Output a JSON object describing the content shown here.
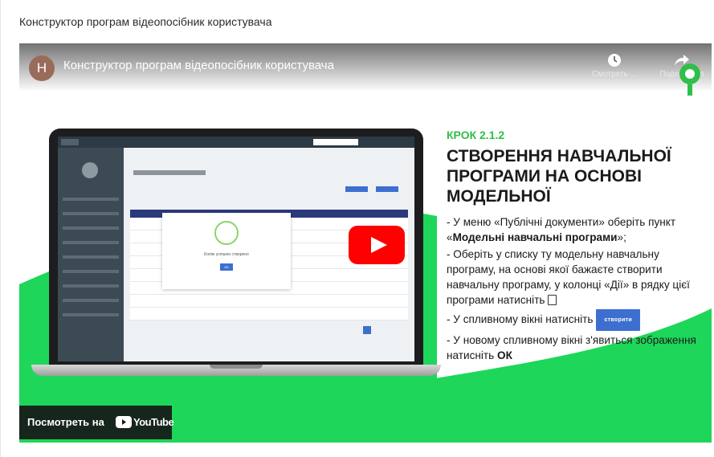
{
  "page": {
    "heading": "Конструктор програм відеопосібник користувача"
  },
  "video": {
    "channel_initial": "Н",
    "title": "Конструктор програм відеопосібник користувача",
    "watch_later_label": "Смотреть ...",
    "share_label": "Поделиться",
    "watch_on_label": "Посмотреть на",
    "youtube_word": "YouTube"
  },
  "slide": {
    "krok": "КРОК 2.1.2",
    "heading_line1": "СТВОРЕННЯ НАВЧАЛЬНОЇ",
    "heading_line2": "ПРОГРАМИ НА ОСНОВІ",
    "heading_line3": "МОДЕЛЬНОЇ",
    "step1_pre": "- У меню «Публічні документи» оберіть пункт «",
    "step1_bold": "Модельні навчальні програми",
    "step1_post": "»;",
    "step2": "- Оберіть у списку ту модельну навчальну програму, на основі якої бажаєте створити навчальну програму, у колонці «Дії» в рядку цієї програми натисніть",
    "step3": "- У спливному вікні натисніть",
    "create_button": "створити",
    "step4_pre": "- У новому спливному вікні з'явиться зображення натисніть ",
    "step4_bold": "ОК",
    "modal_text": "Копію успішно створено",
    "modal_ok": "ОК"
  },
  "colors": {
    "accent_green": "#2fbf4a",
    "swoosh_green": "#1ed65a",
    "button_blue": "#3d6fd1",
    "youtube_red": "#ff0000"
  },
  "icons": {
    "watch_later": "clock-icon",
    "share": "share-arrow-icon",
    "play": "youtube-play-icon"
  }
}
